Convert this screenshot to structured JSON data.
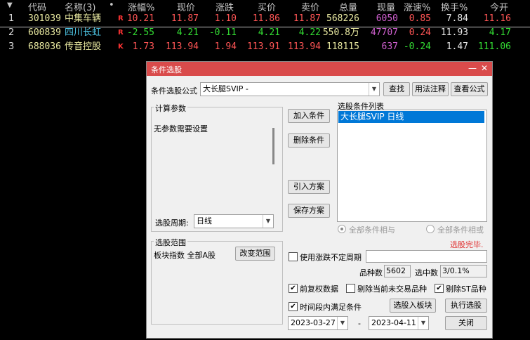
{
  "header": {
    "arrow": "▼",
    "cols": [
      "代码",
      "名称(3)",
      "•",
      "涨幅%",
      "现价",
      "涨跌",
      "买价",
      "卖价",
      "总量",
      "现量",
      "涨速%",
      "换手%",
      "今开"
    ]
  },
  "rows": [
    {
      "idx": "1",
      "code": "301039",
      "name": "中集车辆",
      "flag": "R",
      "pct": "10.21",
      "price": "11.87",
      "chg": "1.10",
      "bid": "11.86",
      "ask": "11.87",
      "vol": "568226",
      "cur": "6050",
      "spd": "0.85",
      "turn": "7.84",
      "open": "11.16"
    },
    {
      "idx": "2",
      "code": "600839",
      "name": "四川长虹",
      "flag": "R",
      "pct": "-2.55",
      "price": "4.21",
      "chg": "-0.11",
      "bid": "4.21",
      "ask": "4.22",
      "vol": "550.8万",
      "cur": "47707",
      "spd": "0.24",
      "turn": "11.93",
      "open": "4.17"
    },
    {
      "idx": "3",
      "code": "688036",
      "name": "传音控股",
      "flag": "K",
      "pct": "1.73",
      "price": "113.94",
      "chg": "1.94",
      "bid": "113.91",
      "ask": "113.94",
      "vol": "118115",
      "cur": "637",
      "spd": "-0.24",
      "turn": "1.47",
      "open": "111.06"
    }
  ],
  "colors": {
    "up": "#ff5555",
    "down": "#33dd33",
    "code": "#e8e8a0",
    "cur": "#d060d0",
    "name_hl": "#4ec8e8",
    "title_bar": "#d94b4b",
    "done": "#e03030"
  },
  "dialog": {
    "title": "条件选股",
    "min_btn": "—",
    "close_btn": "✕",
    "formula_label": "条件选股公式",
    "formula_value": "大长腿SVIP  -",
    "btn_find": "查找",
    "btn_usage": "用法注释",
    "btn_view": "查看公式",
    "params_group": "计算参数",
    "params_text": "无参数需要设置",
    "period_label": "选股周期:",
    "period_value": "日线",
    "btn_add": "加入条件",
    "btn_del": "删除条件",
    "btn_import": "引入方案",
    "btn_save": "保存方案",
    "cond_list_label": "选股条件列表",
    "cond_items": [
      "大长腿SVIP  日线"
    ],
    "radio_and": "全部条件相与",
    "radio_or": "全部条件相或",
    "status": "选股完毕.",
    "range_group": "选股范围",
    "range_text": "板块指数 全部A股",
    "btn_change_range": "改变范围",
    "chk_uncertain": "使用涨跌不定周期",
    "count_label": "品种数",
    "count_value": "5602",
    "hit_label": "选中数",
    "hit_value": "3/0.1%",
    "chk_adjust": "前复权数据",
    "chk_remove_untraded": "剔除当前未交易品种",
    "chk_remove_st": "剔除ST品种",
    "chk_period": "时间段内满足条件",
    "btn_to_block": "选股入板块",
    "btn_run": "执行选股",
    "date_from": "2023-03-27",
    "date_sep": "-",
    "date_to": "2023-04-11",
    "btn_close": "关闭"
  }
}
